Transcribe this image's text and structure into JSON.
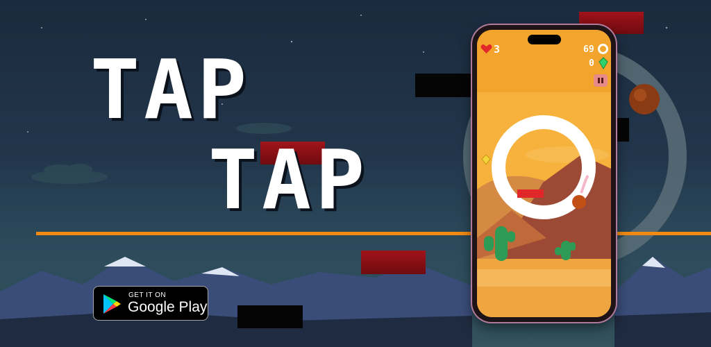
{
  "title": {
    "line1": "TAP",
    "line2": "TAP"
  },
  "store_badge": {
    "small_text": "GET IT ON",
    "store_name": "Google Play"
  },
  "hud": {
    "lives": "3",
    "score": "69",
    "gems": "0"
  },
  "colors": {
    "accent_line": "#f08a12",
    "block_red": "#8c1016",
    "ring": "#ffffff",
    "ball": "#c9521a"
  },
  "icons": [
    "heart-icon",
    "ring-icon",
    "gem-icon",
    "pause-icon",
    "google-play-icon",
    "cactus-icon"
  ]
}
